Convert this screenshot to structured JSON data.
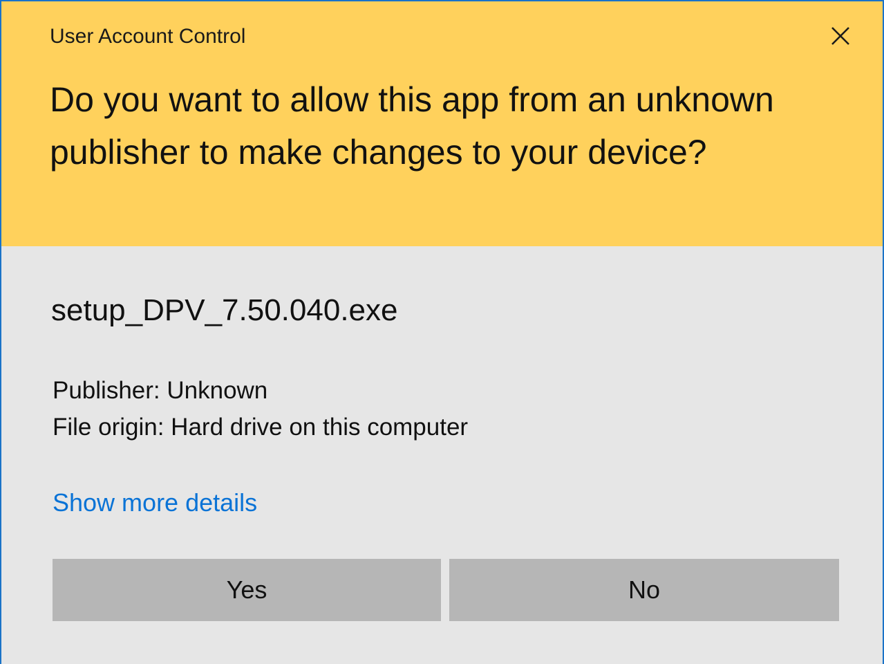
{
  "dialog": {
    "title": "User Account Control",
    "question": "Do you want to allow this app from an unknown publisher to make changes to your device?",
    "file_name": "setup_DPV_7.50.040.exe",
    "publisher": "Publisher: Unknown",
    "file_origin": "File origin: Hard drive on this computer",
    "details_link": "Show more details",
    "yes_label": "Yes",
    "no_label": "No",
    "close_icon": "close-icon"
  },
  "colors": {
    "header_bg": "#ffd15c",
    "body_bg": "#e6e6e6",
    "link": "#0a73d6",
    "button_bg": "#b6b6b6",
    "border": "#1a73c8"
  }
}
